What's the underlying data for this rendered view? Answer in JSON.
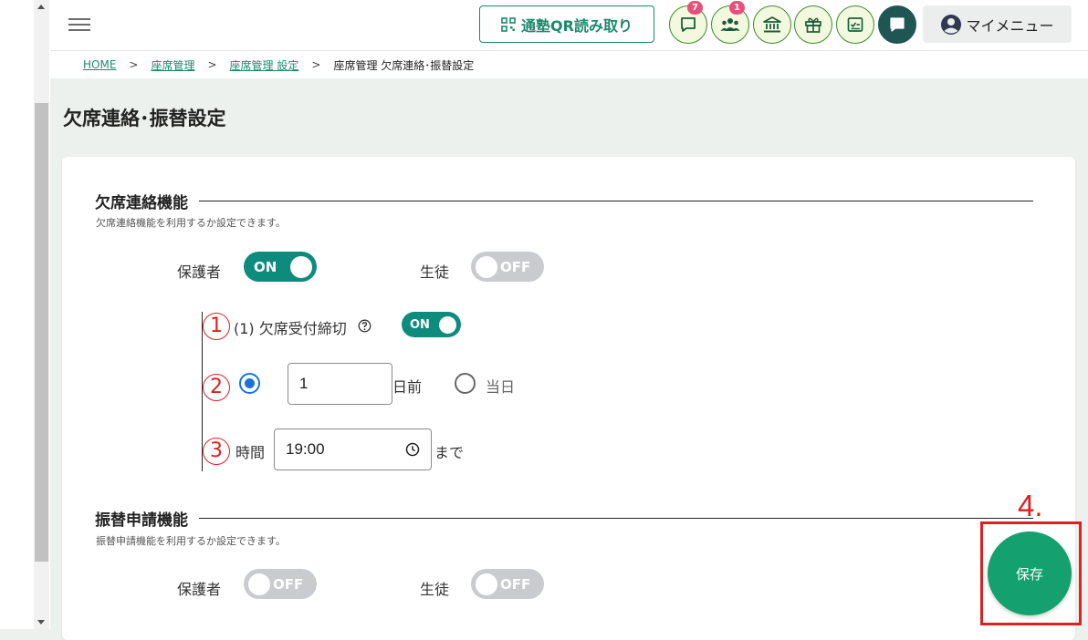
{
  "header": {
    "qr_button_label": "通塾QR読み取り",
    "badges": {
      "messages": "7",
      "students": "1"
    },
    "my_menu_label": "マイメニュー"
  },
  "breadcrumb": {
    "home": "HOME",
    "seat_management": "座席管理",
    "seat_settings": "座席管理 設定",
    "current": "座席管理 欠席連絡･振替設定"
  },
  "page": {
    "title": "欠席連絡･振替設定"
  },
  "absence": {
    "heading": "欠席連絡機能",
    "description": "欠席連絡機能を利用するか設定できます。",
    "guardian_label": "保護者",
    "guardian_toggle": "ON",
    "student_label": "生徒",
    "student_toggle": "OFF",
    "deadline_label": "(1) 欠席受付締切",
    "deadline_toggle": "ON",
    "days_value": "1",
    "days_before_label": "日前",
    "same_day_label": "当日",
    "time_label": "時間",
    "time_value": "19:00",
    "until_label": "まで"
  },
  "annotations": {
    "one": "1",
    "two": "2",
    "three": "3",
    "four": "4."
  },
  "transfer": {
    "heading": "振替申請機能",
    "description": "振替申請機能を利用するか設定できます。",
    "guardian_label": "保護者",
    "guardian_toggle": "OFF",
    "student_label": "生徒",
    "student_toggle": "OFF"
  },
  "save_label": "保存",
  "colors": {
    "primary": "#0d8c7e",
    "save": "#14a06f",
    "annotation": "#e02020",
    "radio": "#1a73d9"
  }
}
